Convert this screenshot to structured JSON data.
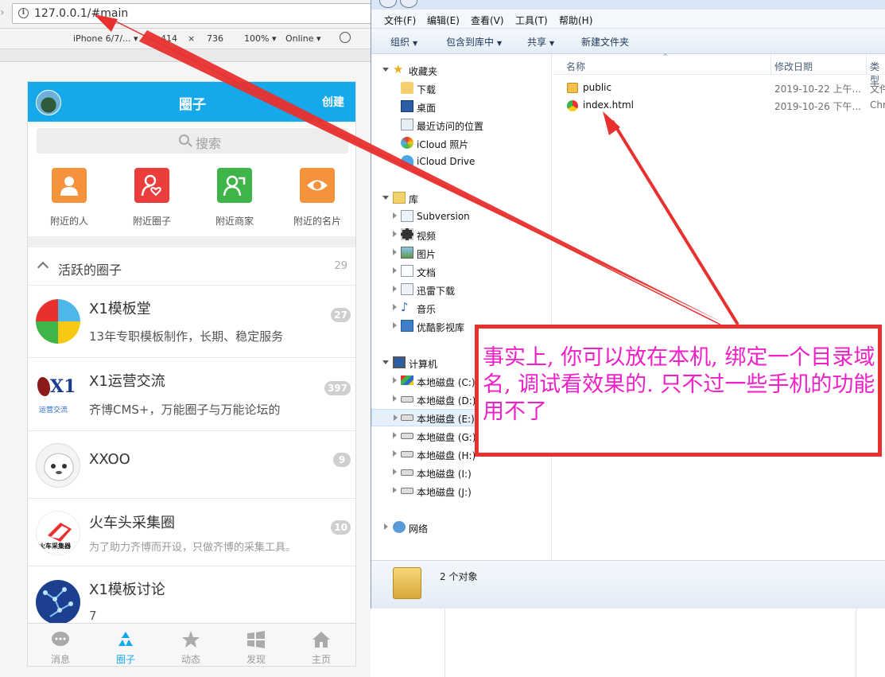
{
  "browser": {
    "url": "127.0.0.1/#main",
    "device": "iPhone 6/7/...",
    "width": "414",
    "times": "×",
    "height": "736",
    "zoom": "100%",
    "network": "Online"
  },
  "phone": {
    "title": "圈子",
    "create_label": "创建",
    "search_placeholder": "搜索",
    "quick": [
      {
        "label": "附近的人",
        "color": "#f6913c"
      },
      {
        "label": "附近圈子",
        "color": "#ec3d3d"
      },
      {
        "label": "附近商家",
        "color": "#3fb549"
      },
      {
        "label": "附近的名片",
        "color": "#f6913c"
      }
    ],
    "section": {
      "title": "活跃的圈子",
      "count": "29"
    },
    "circles": [
      {
        "name": "X1模板堂",
        "desc": "13年专职模板制作，长期、稳定服务",
        "badge": "27"
      },
      {
        "name": "X1运营交流",
        "desc": "齐博CMS+，万能圈子与万能论坛的",
        "badge": "397",
        "avatar_text": "X1",
        "avatar_caption": "运营交流"
      },
      {
        "name": "XXOO",
        "desc": "",
        "badge": "9"
      },
      {
        "name": "火车头采集圈",
        "desc": "为了助力齐博而开设，只做齐博的采集工具。",
        "badge": "10",
        "avatar_caption": "火车采集器"
      },
      {
        "name": "X1模板讨论",
        "desc": "7",
        "badge": ""
      }
    ],
    "tabs": [
      {
        "label": "消息"
      },
      {
        "label": "圈子"
      },
      {
        "label": "动态"
      },
      {
        "label": "发现"
      },
      {
        "label": "主页"
      }
    ],
    "accent": "#15a9ec"
  },
  "explorer": {
    "menu": [
      "文件(F)",
      "编辑(E)",
      "查看(V)",
      "工具(T)",
      "帮助(H)"
    ],
    "toolbar": [
      "组织",
      "包含到库中",
      "共享",
      "新建文件夹"
    ],
    "favorites": {
      "title": "收藏夹",
      "items": [
        "下载",
        "桌面",
        "最近访问的位置",
        "iCloud 照片",
        "iCloud Drive"
      ]
    },
    "library": {
      "title": "库",
      "items": [
        "Subversion",
        "视频",
        "图片",
        "文档",
        "迅雷下载",
        "音乐",
        "优酷影视库"
      ]
    },
    "computer": {
      "title": "计算机",
      "items": [
        "本地磁盘 (C:)",
        "本地磁盘 (D:)",
        "本地磁盘 (E:)",
        "本地磁盘 (G:)",
        "本地磁盘 (H:)",
        "本地磁盘 (I:)",
        "本地磁盘 (J:)"
      ]
    },
    "network": "网络",
    "columns": [
      "名称",
      "修改日期",
      "类型"
    ],
    "files": [
      {
        "name": "public",
        "date": "2019-10-22 上午...",
        "type": "文件"
      },
      {
        "name": "index.html",
        "date": "2019-10-26 下午...",
        "type": "Chr"
      }
    ],
    "status": "2 个对象"
  },
  "annotation": {
    "text": "事实上, 你可以放在本机, 绑定一个目录域名, 调试看效果的. 只不过一些手机的功能用不了"
  }
}
